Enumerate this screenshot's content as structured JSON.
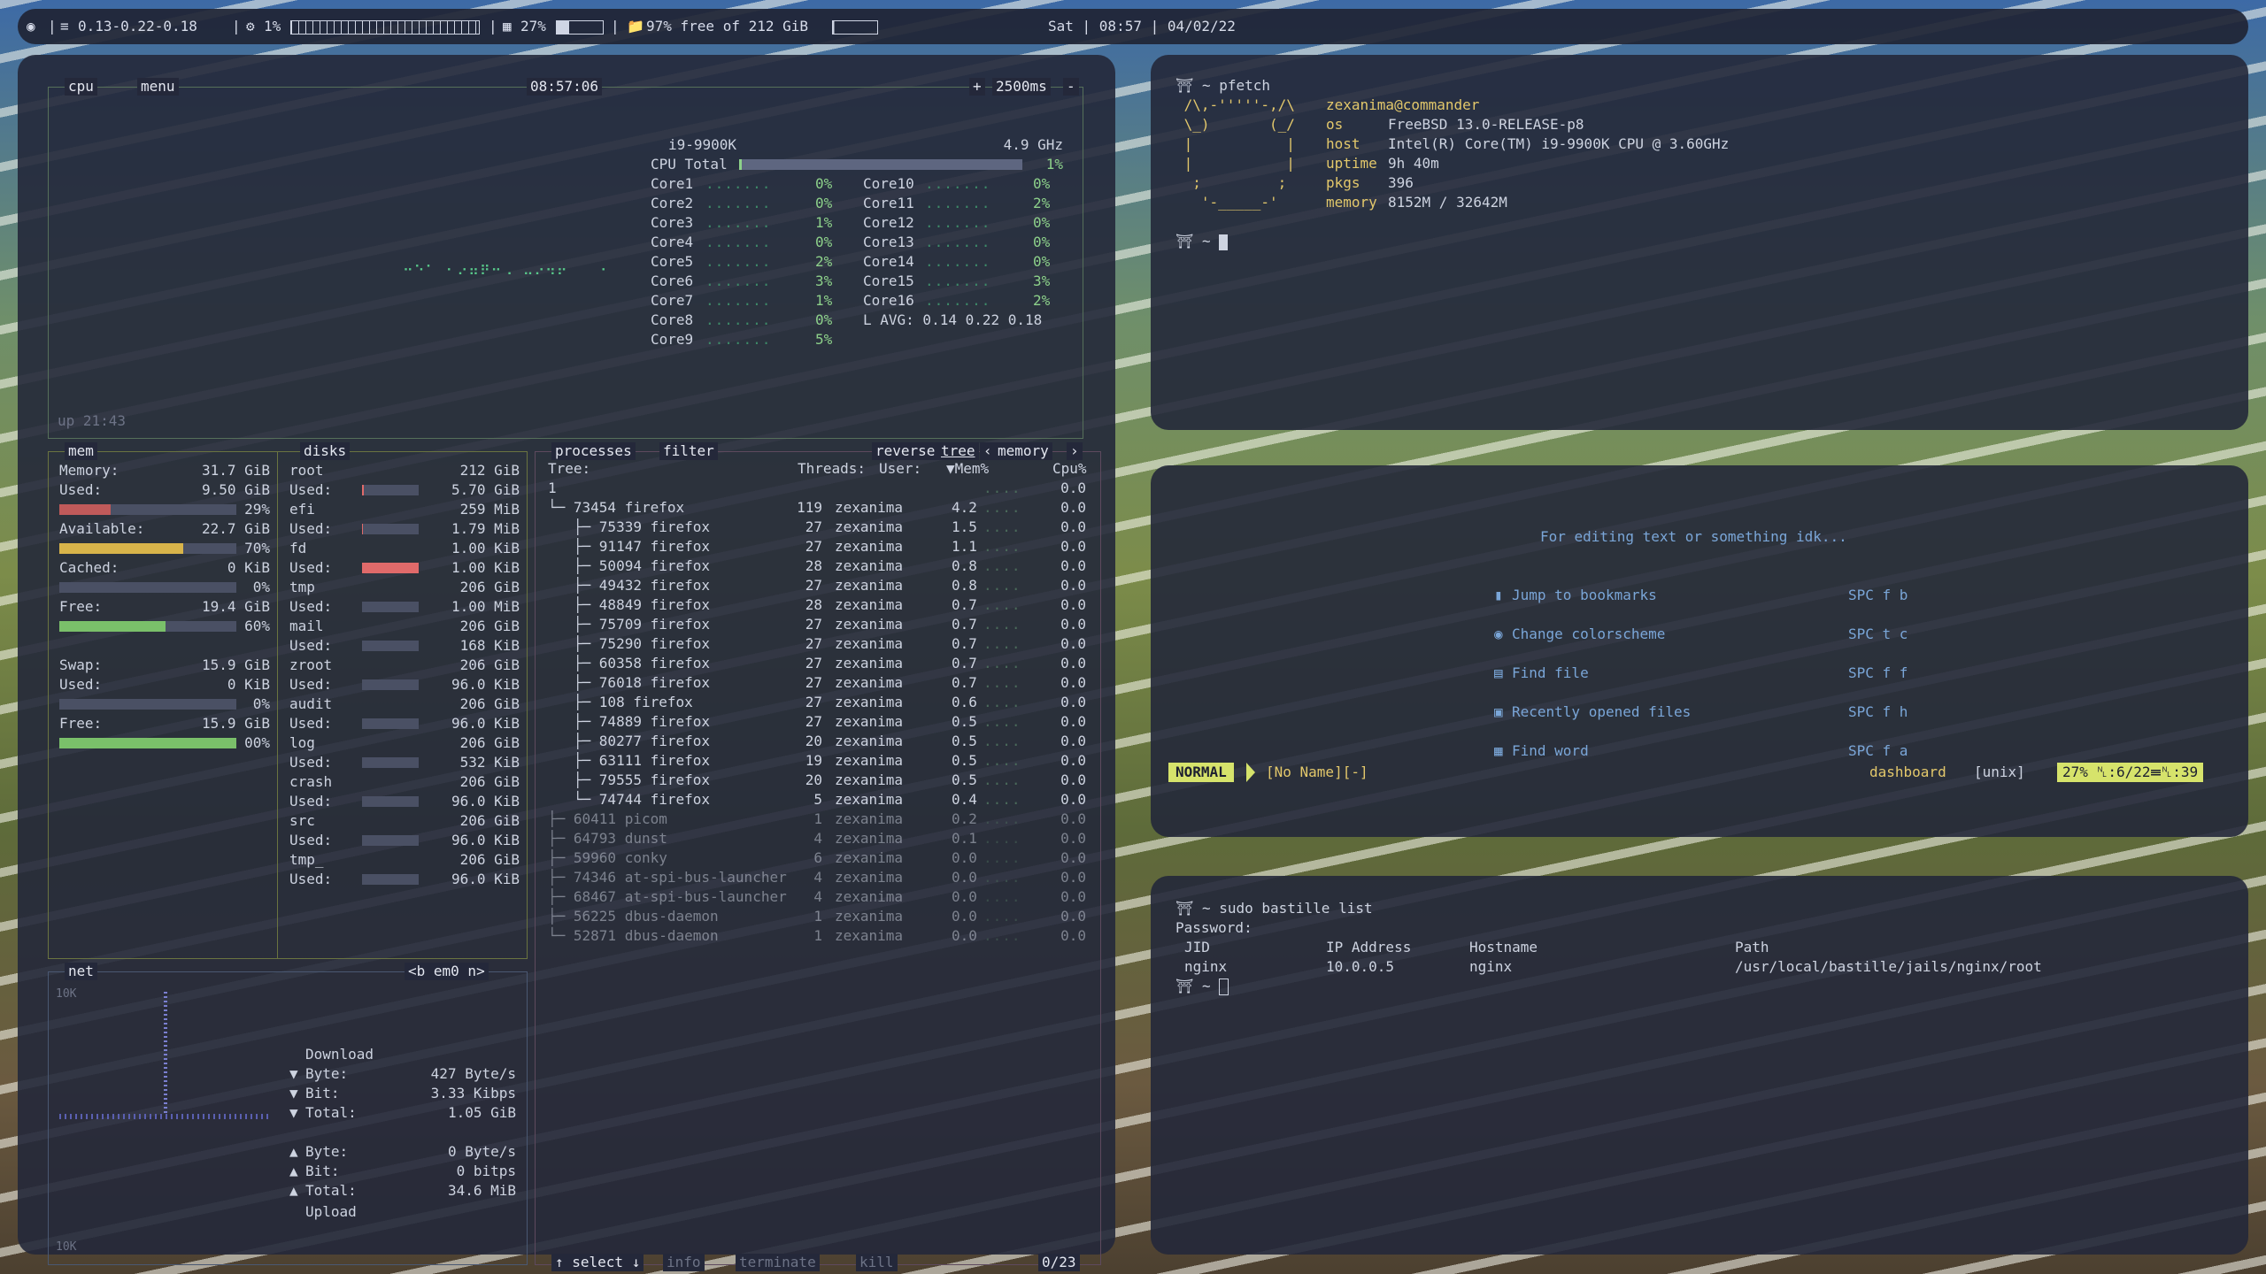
{
  "topbar": {
    "load": "0.13-0.22-0.18",
    "cpu": "1%",
    "mem": "27%",
    "disk": "97% free of 212 GiB",
    "datetime": "Sat | 08:57 | 04/02/22",
    "sep": "|"
  },
  "btop": {
    "cpu_label": "cpu",
    "menu_label": "menu",
    "clock": "08:57:06",
    "interval": "2500ms",
    "interval_plus": "+",
    "interval_minus": "-",
    "uptime": "up 21:43",
    "cpu_model": "i9-9900K",
    "cpu_freq": "4.9 GHz",
    "cpu_total_label": "CPU Total",
    "cpu_total": "1%",
    "cores_left": [
      {
        "name": "Core1",
        "pct": "0%"
      },
      {
        "name": "Core2",
        "pct": "0%"
      },
      {
        "name": "Core3",
        "pct": "1%"
      },
      {
        "name": "Core4",
        "pct": "0%"
      },
      {
        "name": "Core5",
        "pct": "2%"
      },
      {
        "name": "Core6",
        "pct": "3%"
      },
      {
        "name": "Core7",
        "pct": "1%"
      },
      {
        "name": "Core8",
        "pct": "0%"
      },
      {
        "name": "Core9",
        "pct": "5%"
      }
    ],
    "cores_right": [
      {
        "name": "Core10",
        "pct": "0%"
      },
      {
        "name": "Core11",
        "pct": "2%"
      },
      {
        "name": "Core12",
        "pct": "0%"
      },
      {
        "name": "Core13",
        "pct": "0%"
      },
      {
        "name": "Core14",
        "pct": "0%"
      },
      {
        "name": "Core15",
        "pct": "3%"
      },
      {
        "name": "Core16",
        "pct": "2%"
      }
    ],
    "lavg": "L AVG: 0.14 0.22 0.18",
    "mem_label": "mem",
    "disks_label": "disks",
    "mem": {
      "memory_label": "Memory:",
      "memory": "31.7 GiB",
      "used_label": "Used:",
      "used": "9.50 GiB",
      "used_pct": "29%",
      "used_frac": 0.29,
      "avail_label": "Available:",
      "avail": "22.7 GiB",
      "avail_pct": "70%",
      "avail_frac": 0.7,
      "cached_label": "Cached:",
      "cached": "0 KiB",
      "cached_pct": "0%",
      "cached_frac": 0,
      "free_label": "Free:",
      "free": "19.4 GiB",
      "free_pct": "60%",
      "free_frac": 0.6,
      "swap_label": "Swap:",
      "swap": "15.9 GiB",
      "swap_used_label": "Used:",
      "swap_used": "0 KiB",
      "swap_used_pct": "0%",
      "swap_used_frac": 0,
      "swap_free_label": "Free:",
      "swap_free": "15.9 GiB",
      "swap_free_pct": "00%",
      "swap_free_frac": 1.0
    },
    "disks": [
      {
        "name": "root",
        "size": "212 GiB",
        "used": "5.70 GiB",
        "frac": 0.03
      },
      {
        "name": "efi",
        "size": "259 MiB",
        "used": "1.79 MiB",
        "frac": 0.01
      },
      {
        "name": "fd",
        "size": "1.00 KiB",
        "used": "1.00 KiB",
        "frac": 1.0
      },
      {
        "name": "tmp",
        "size": "206 GiB",
        "used": "1.00 MiB",
        "frac": 0.0
      },
      {
        "name": "mail",
        "size": "206 GiB",
        "used": "168 KiB",
        "frac": 0.0
      },
      {
        "name": "zroot",
        "size": "206 GiB",
        "used": "96.0 KiB",
        "frac": 0.0
      },
      {
        "name": "audit",
        "size": "206 GiB",
        "used": "96.0 KiB",
        "frac": 0.0
      },
      {
        "name": "log",
        "size": "206 GiB",
        "used": "532 KiB",
        "frac": 0.0
      },
      {
        "name": "crash",
        "size": "206 GiB",
        "used": "96.0 KiB",
        "frac": 0.0
      },
      {
        "name": "src",
        "size": "206 GiB",
        "used": "96.0 KiB",
        "frac": 0.0
      },
      {
        "name": "tmp_",
        "size": "206 GiB",
        "used": "96.0 KiB",
        "frac": 0.0
      }
    ],
    "disk_used_label": "Used:",
    "net_label": "net",
    "net_iface": "<b em0 n>",
    "net_scale_top": "10K",
    "net_scale_bottom": "10K",
    "download_label": "Download",
    "download": [
      {
        "label": "Byte:",
        "val": "427 Byte/s"
      },
      {
        "label": "Bit:",
        "val": "3.33 Kibps"
      },
      {
        "label": "Total:",
        "val": "1.05 GiB"
      }
    ],
    "upload": [
      {
        "label": "Byte:",
        "val": "0 Byte/s"
      },
      {
        "label": "Bit:",
        "val": "0 bitps"
      },
      {
        "label": "Total:",
        "val": "34.6 MiB"
      }
    ],
    "upload_label": "Upload",
    "proc_label": "processes",
    "filter_label": "filter",
    "reverse_label": "reverse",
    "tree_label": "tree",
    "sort_label": "memory",
    "proc_header": {
      "tree": "Tree:",
      "threads": "Threads:",
      "user": "User:",
      "mem": "Mem%",
      "cpu": "Cpu%"
    },
    "procs": [
      {
        "tree": "1",
        "threads": "",
        "user": "",
        "mem": "",
        "cpu": "0.0",
        "dim": false
      },
      {
        "tree": "└─ 73454 firefox",
        "threads": "119",
        "user": "zexanima",
        "mem": "4.2",
        "cpu": "0.0",
        "dim": false
      },
      {
        "tree": "   ├─ 75339 firefox",
        "threads": "27",
        "user": "zexanima",
        "mem": "1.5",
        "cpu": "0.0",
        "dim": false
      },
      {
        "tree": "   ├─ 91147 firefox",
        "threads": "27",
        "user": "zexanima",
        "mem": "1.1",
        "cpu": "0.0",
        "dim": false
      },
      {
        "tree": "   ├─ 50094 firefox",
        "threads": "28",
        "user": "zexanima",
        "mem": "0.8",
        "cpu": "0.0",
        "dim": false
      },
      {
        "tree": "   ├─ 49432 firefox",
        "threads": "27",
        "user": "zexanima",
        "mem": "0.8",
        "cpu": "0.0",
        "dim": false
      },
      {
        "tree": "   ├─ 48849 firefox",
        "threads": "28",
        "user": "zexanima",
        "mem": "0.7",
        "cpu": "0.0",
        "dim": false
      },
      {
        "tree": "   ├─ 75709 firefox",
        "threads": "27",
        "user": "zexanima",
        "mem": "0.7",
        "cpu": "0.0",
        "dim": false
      },
      {
        "tree": "   ├─ 75290 firefox",
        "threads": "27",
        "user": "zexanima",
        "mem": "0.7",
        "cpu": "0.0",
        "dim": false
      },
      {
        "tree": "   ├─ 60358 firefox",
        "threads": "27",
        "user": "zexanima",
        "mem": "0.7",
        "cpu": "0.0",
        "dim": false
      },
      {
        "tree": "   ├─ 76018 firefox",
        "threads": "27",
        "user": "zexanima",
        "mem": "0.7",
        "cpu": "0.0",
        "dim": false
      },
      {
        "tree": "   ├─ 108 firefox",
        "threads": "27",
        "user": "zexanima",
        "mem": "0.6",
        "cpu": "0.0",
        "dim": false
      },
      {
        "tree": "   ├─ 74889 firefox",
        "threads": "27",
        "user": "zexanima",
        "mem": "0.5",
        "cpu": "0.0",
        "dim": false
      },
      {
        "tree": "   ├─ 80277 firefox",
        "threads": "20",
        "user": "zexanima",
        "mem": "0.5",
        "cpu": "0.0",
        "dim": false
      },
      {
        "tree": "   ├─ 63111 firefox",
        "threads": "19",
        "user": "zexanima",
        "mem": "0.5",
        "cpu": "0.0",
        "dim": false
      },
      {
        "tree": "   ├─ 79555 firefox",
        "threads": "20",
        "user": "zexanima",
        "mem": "0.5",
        "cpu": "0.0",
        "dim": false
      },
      {
        "tree": "   └─ 74744 firefox",
        "threads": "5",
        "user": "zexanima",
        "mem": "0.4",
        "cpu": "0.0",
        "dim": false
      },
      {
        "tree": "├─ 60411 picom",
        "threads": "1",
        "user": "zexanima",
        "mem": "0.2",
        "cpu": "0.0",
        "dim": true
      },
      {
        "tree": "├─ 64793 dunst",
        "threads": "4",
        "user": "zexanima",
        "mem": "0.1",
        "cpu": "0.0",
        "dim": true
      },
      {
        "tree": "├─ 59960 conky",
        "threads": "6",
        "user": "zexanima",
        "mem": "0.0",
        "cpu": "0.0",
        "dim": true
      },
      {
        "tree": "├─ 74346 at-spi-bus-launcher",
        "threads": "4",
        "user": "zexanima",
        "mem": "0.0",
        "cpu": "0.0",
        "dim": true
      },
      {
        "tree": "├─ 68467 at-spi-bus-launcher",
        "threads": "4",
        "user": "zexanima",
        "mem": "0.0",
        "cpu": "0.0",
        "dim": true
      },
      {
        "tree": "├─ 56225 dbus-daemon",
        "threads": "1",
        "user": "zexanima",
        "mem": "0.0",
        "cpu": "0.0",
        "dim": true
      },
      {
        "tree": "└─ 52871 dbus-daemon",
        "threads": "1",
        "user": "zexanima",
        "mem": "0.0",
        "cpu": "0.0",
        "dim": true
      }
    ],
    "select_label": "↑ select ↓",
    "info_label": "info",
    "terminate_label": "terminate",
    "kill_label": "kill",
    "proc_count": "0/23"
  },
  "pfetch": {
    "prompt": "⛩ ~ pfetch",
    "art": [
      " /\\,-'''''-,/\\",
      " \\_)       (_/",
      " |           |",
      " |           |",
      "  ;         ;",
      "   '-_____-'"
    ],
    "userhost": "zexanima@commander",
    "fields": [
      {
        "k": "os",
        "v": "FreeBSD 13.0-RELEASE-p8"
      },
      {
        "k": "host",
        "v": "Intel(R) Core(TM) i9-9900K CPU @ 3.60GHz"
      },
      {
        "k": "uptime",
        "v": "9h 40m"
      },
      {
        "k": "pkgs",
        "v": "396"
      },
      {
        "k": "memory",
        "v": "8152M / 32642M"
      }
    ],
    "prompt2": "⛩ ~"
  },
  "vim": {
    "tagline": "For editing text or something idk...",
    "items": [
      {
        "label": "Jump to bookmarks",
        "key": "SPC f b"
      },
      {
        "label": "Change colorscheme",
        "key": "SPC t c"
      },
      {
        "label": "Find file",
        "key": "SPC f f"
      },
      {
        "label": "Recently opened files",
        "key": "SPC f h"
      },
      {
        "label": "Find word",
        "key": "SPC f a"
      }
    ],
    "mode": "NORMAL",
    "buffer": "[No Name][-]",
    "filetype": "dashboard",
    "format": "[unix]",
    "position": "27% ␤:6/22☰␤:39"
  },
  "bastille": {
    "cmd": "⛩ ~ sudo bastille list",
    "password": "Password:",
    "headers": {
      "jid": "JID",
      "ip": "IP Address",
      "host": "Hostname",
      "path": "Path"
    },
    "row": {
      "jid": "nginx",
      "ip": "10.0.0.5",
      "host": "nginx",
      "path": "/usr/local/bastille/jails/nginx/root"
    },
    "prompt": "⛩ ~"
  },
  "colors": {
    "accent_green": "#8dd18a",
    "accent_yellow": "#e3c86b",
    "accent_red": "#e06a6a",
    "vim_mode": "#d6e36b"
  }
}
